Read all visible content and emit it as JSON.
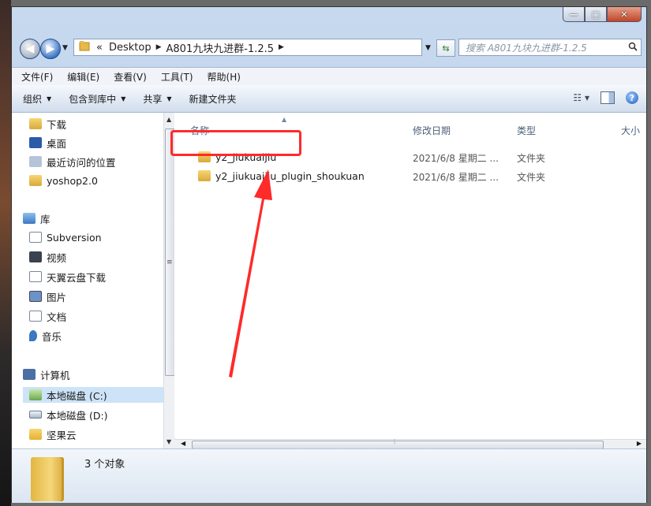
{
  "window": {
    "controls": {
      "minimize": "—",
      "maximize": "□",
      "close": "✕"
    }
  },
  "nav": {
    "breadcrumb_prefix": "«",
    "crumbs": [
      "Desktop",
      "A801九块九进群-1.2.5"
    ],
    "search_placeholder": "搜索 A801九块九进群-1.2.5"
  },
  "menubar": [
    "文件(F)",
    "编辑(E)",
    "查看(V)",
    "工具(T)",
    "帮助(H)"
  ],
  "toolbar": {
    "organize": "组织",
    "include_library": "包含到库中",
    "share": "共享",
    "new_folder": "新建文件夹"
  },
  "sidebar": {
    "items": [
      {
        "label": "下载",
        "icon": "download-folder-icon"
      },
      {
        "label": "桌面",
        "icon": "desktop-icon"
      },
      {
        "label": "最近访问的位置",
        "icon": "recent-places-icon"
      },
      {
        "label": "yoshop2.0",
        "icon": "folder-icon"
      },
      {
        "label": "库",
        "icon": "library-icon"
      },
      {
        "label": "Subversion",
        "icon": "document-library-icon"
      },
      {
        "label": "视频",
        "icon": "video-icon"
      },
      {
        "label": "天翼云盘下载",
        "icon": "document-library-icon"
      },
      {
        "label": "图片",
        "icon": "pictures-icon"
      },
      {
        "label": "文档",
        "icon": "documents-icon"
      },
      {
        "label": "音乐",
        "icon": "music-icon"
      },
      {
        "label": "计算机",
        "icon": "computer-icon"
      },
      {
        "label": "本地磁盘 (C:)",
        "icon": "drive-c-icon"
      },
      {
        "label": "本地磁盘 (D:)",
        "icon": "drive-d-icon"
      },
      {
        "label": "坚果云",
        "icon": "jianguoyun-icon"
      }
    ]
  },
  "columns": {
    "name": "名称",
    "modified": "修改日期",
    "type": "类型",
    "size": "大小"
  },
  "files": [
    {
      "name": "y2_jiukuaijiu",
      "modified": "2021/6/8 星期二 ...",
      "type": "文件夹"
    },
    {
      "name": "y2_jiukuaijiu_plugin_shoukuan",
      "modified": "2021/6/8 星期二 ...",
      "type": "文件夹"
    }
  ],
  "details": {
    "count": "3 个对象"
  },
  "colors": {
    "annotation": "#ff2a2a",
    "selection": "#cde3f7"
  }
}
